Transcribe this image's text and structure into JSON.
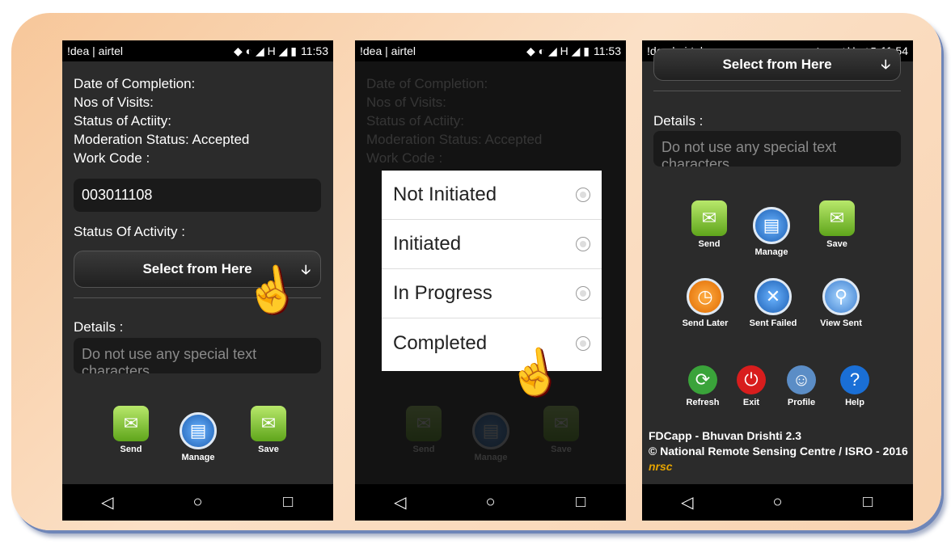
{
  "status": {
    "carrier": "!dea | airtel",
    "time1": "11:53",
    "time2": "11:53",
    "time3": "11:54",
    "signal_icons": "◆ ◐ ◢ H ◢ ▮"
  },
  "form": {
    "date_label": "Date of Completion:",
    "visits_label": "Nos of Visits:",
    "status_label": "Status of Actiity:",
    "moderation_label": "Moderation Status: Accepted",
    "workcode_label": "Work Code :",
    "workcode_value": "003011108",
    "activity_label": "Status Of Activity :",
    "select_label": "Select from Here",
    "details_label": "Details :",
    "details_placeholder": "Do not use any special text characters"
  },
  "dialog": {
    "options": [
      "Not Initiated",
      "Initiated",
      "In Progress",
      "Completed"
    ]
  },
  "buttons": {
    "send": "Send",
    "manage": "Manage",
    "save": "Save",
    "send_later": "Send Later",
    "sent_failed": "Sent Failed",
    "view_sent": "View Sent",
    "refresh": "Refresh",
    "exit": "Exit",
    "profile": "Profile",
    "help": "Help"
  },
  "footer": {
    "app": "FDCapp - Bhuvan Drishti 2.3",
    "credit": "© National Remote Sensing Centre / ISRO - 2016",
    "nrsc": "nrsc"
  },
  "nav": {
    "back": "◁",
    "home": "○",
    "recent": "□"
  }
}
